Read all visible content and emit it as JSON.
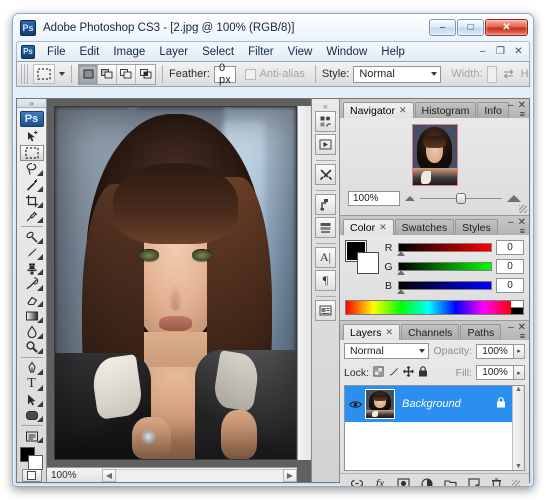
{
  "window": {
    "title": "Adobe Photoshop CS3 - [2.jpg @ 100% (RGB/8)]",
    "logo_text": "Ps",
    "minimize": "–",
    "maximize": "□",
    "close": "✕"
  },
  "menubar": {
    "items": [
      "File",
      "Edit",
      "Image",
      "Layer",
      "Select",
      "Filter",
      "View",
      "Window",
      "Help"
    ],
    "mdi_minimize": "–",
    "mdi_restore": "❐",
    "mdi_close": "✕"
  },
  "options_bar": {
    "tool_icon": "rectangular-marquee",
    "selection_modes": [
      "new-selection",
      "add-to-selection",
      "subtract-from-selection",
      "intersect-selection"
    ],
    "feather_label": "Feather:",
    "feather_value": "0 px",
    "antialias_label": "Anti-alias",
    "antialias_checked": false,
    "style_label": "Style:",
    "style_value": "Normal",
    "width_label": "Width:",
    "width_value": "",
    "height_label": "Height:",
    "height_value": "",
    "swap_icon": "⇄"
  },
  "toolbox": {
    "logo_text": "Ps",
    "grip": "»",
    "tools": [
      {
        "name": "move-tool",
        "glyph": "✣"
      },
      {
        "name": "rectangular-marquee-tool",
        "glyph": "⬚",
        "active": true
      },
      {
        "name": "lasso-tool",
        "glyph": "❦"
      },
      {
        "name": "magic-wand-tool",
        "glyph": "✦"
      },
      {
        "name": "crop-tool",
        "glyph": "⌗"
      },
      {
        "name": "eyedropper-tool",
        "glyph": "✒"
      },
      {
        "name": "healing-brush-tool",
        "glyph": "✐"
      },
      {
        "name": "brush-tool",
        "glyph": "✎"
      },
      {
        "name": "clone-stamp-tool",
        "glyph": "⚑"
      },
      {
        "name": "history-brush-tool",
        "glyph": "✇"
      },
      {
        "name": "eraser-tool",
        "glyph": "▱"
      },
      {
        "name": "gradient-tool",
        "glyph": "▤"
      },
      {
        "name": "blur-tool",
        "glyph": "●"
      },
      {
        "name": "dodge-tool",
        "glyph": "⚲"
      },
      {
        "name": "pen-tool",
        "glyph": "✑"
      },
      {
        "name": "type-tool",
        "glyph": "T"
      },
      {
        "name": "path-selection-tool",
        "glyph": "➤"
      },
      {
        "name": "shape-tool",
        "glyph": "▭"
      },
      {
        "name": "notes-tool",
        "glyph": "☰"
      }
    ],
    "foreground_color": "#000000",
    "background_color": "#ffffff",
    "screen_mode": "standard-screen-mode"
  },
  "document": {
    "zoom": "100%",
    "status_button": "document-status-menu",
    "scroll_left_arrow": "◀",
    "scroll_right_arrow": "▶",
    "scroll_up_arrow": "▲",
    "scroll_down_arrow": "▼"
  },
  "right_dock": {
    "grip": "«",
    "icons": [
      {
        "name": "brushes-panel-icon",
        "glyph": "▒"
      },
      {
        "name": "animation-panel-icon",
        "glyph": "▶"
      },
      {
        "name": "tool-presets-panel-icon",
        "glyph": "⚔"
      },
      {
        "name": "clone-source-panel-icon",
        "glyph": "⑂"
      },
      {
        "name": "layer-comps-panel-icon",
        "glyph": "☷"
      },
      {
        "name": "character-panel-icon",
        "glyph": "A"
      },
      {
        "name": "paragraph-panel-icon",
        "glyph": "¶"
      },
      {
        "name": "notes-panel-icon",
        "glyph": "☰"
      }
    ]
  },
  "navigator_panel": {
    "tabs": [
      {
        "label": "Navigator",
        "active": true,
        "closable": true
      },
      {
        "label": "Histogram",
        "active": false,
        "closable": false
      },
      {
        "label": "Info",
        "active": false,
        "closable": false
      }
    ],
    "zoom_value": "100%",
    "minimize": "–",
    "close": "✕",
    "menu": "≡"
  },
  "color_panel": {
    "tabs": [
      {
        "label": "Color",
        "active": true,
        "closable": true
      },
      {
        "label": "Swatches",
        "active": false,
        "closable": false
      },
      {
        "label": "Styles",
        "active": false,
        "closable": false
      }
    ],
    "channels": [
      {
        "label": "R",
        "value": "0"
      },
      {
        "label": "G",
        "value": "0"
      },
      {
        "label": "B",
        "value": "0"
      }
    ],
    "foreground_color": "#000000",
    "background_color": "#ffffff",
    "minimize": "–",
    "close": "✕",
    "menu": "≡"
  },
  "layers_panel": {
    "tabs": [
      {
        "label": "Layers",
        "active": true,
        "closable": true
      },
      {
        "label": "Channels",
        "active": false,
        "closable": false
      },
      {
        "label": "Paths",
        "active": false,
        "closable": false
      }
    ],
    "blend_mode": "Normal",
    "opacity_label": "Opacity:",
    "opacity_value": "100%",
    "lock_label": "Lock:",
    "lock_icons": [
      {
        "name": "lock-transparent-pixels-icon",
        "glyph": "▨"
      },
      {
        "name": "lock-image-pixels-icon",
        "glyph": "✎"
      },
      {
        "name": "lock-position-icon",
        "glyph": "✜"
      },
      {
        "name": "lock-all-icon",
        "glyph": "ὑ2"
      }
    ],
    "fill_label": "Fill:",
    "fill_value": "100%",
    "layers": [
      {
        "name": "Background",
        "visible": true,
        "locked": true,
        "selected": true
      }
    ],
    "eye_glyph": "◉",
    "lock_glyph": "ʘ",
    "footer_icons": [
      {
        "name": "link-layers-icon",
        "glyph": "⚭"
      },
      {
        "name": "layer-style-icon",
        "glyph": "ƒˣ"
      },
      {
        "name": "layer-mask-icon",
        "glyph": "▣"
      },
      {
        "name": "adjustment-layer-icon",
        "glyph": "◑"
      },
      {
        "name": "new-group-icon",
        "glyph": "▱"
      },
      {
        "name": "new-layer-icon",
        "glyph": "❐"
      },
      {
        "name": "delete-layer-icon",
        "glyph": "⛃"
      }
    ],
    "minimize": "–",
    "close": "✕",
    "menu": "≡"
  },
  "colors": {
    "selection_blue": "#2a8ff0",
    "title_accent": "#c62c18",
    "panel_bg": "#dcdcdc"
  }
}
